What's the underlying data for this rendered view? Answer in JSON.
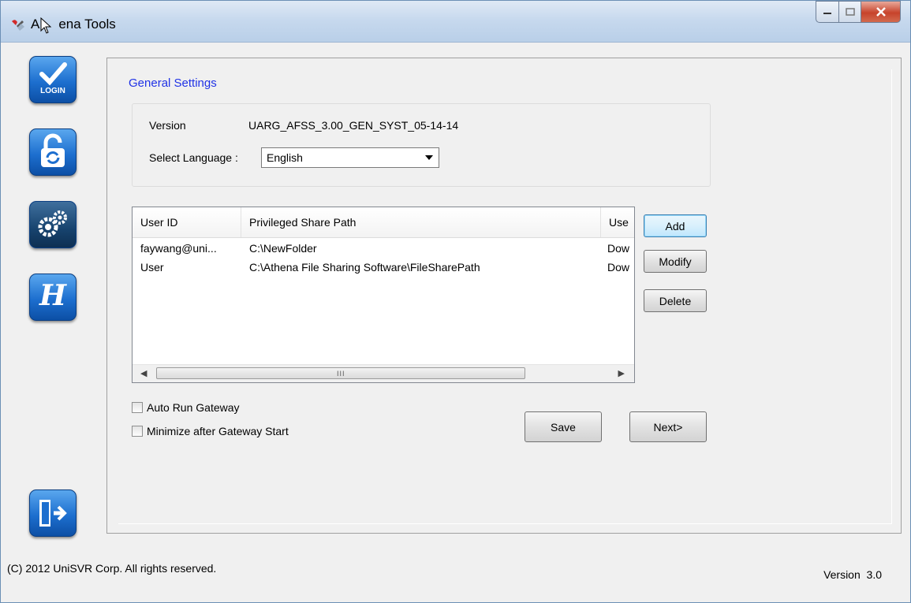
{
  "window": {
    "title": "Athena Tools",
    "title_prefix": "A",
    "title_suffix": "ena Tools"
  },
  "sidebar": {
    "items": [
      {
        "name": "login",
        "label": "LOGIN"
      },
      {
        "name": "unlock-refresh"
      },
      {
        "name": "settings-gears"
      },
      {
        "name": "help-h",
        "label": "H"
      },
      {
        "name": "exit"
      }
    ]
  },
  "general": {
    "title": "General Settings",
    "version_label": "Version",
    "version_value": "UARG_AFSS_3.00_GEN_SYST_05-14-14",
    "language_label": "Select Language :",
    "language_value": "English"
  },
  "table": {
    "columns": [
      "User ID",
      "Privileged Share Path",
      "Use"
    ],
    "rows": [
      {
        "user_id": "faywang@uni...",
        "path": "C:\\NewFolder",
        "use": "Dow"
      },
      {
        "user_id": "User",
        "path": "C:\\Athena File Sharing Software\\FileSharePath",
        "use": "Dow"
      }
    ],
    "scroll_grip": "III"
  },
  "buttons": {
    "add": "Add",
    "modify": "Modify",
    "delete": "Delete",
    "save": "Save",
    "next": "Next>"
  },
  "options": {
    "auto_run": "Auto Run Gateway",
    "minimize": "Minimize after Gateway Start"
  },
  "footer": {
    "copyright": "(C) 2012 UniSVR Corp. All rights reserved.",
    "version": "Version  3.0"
  }
}
